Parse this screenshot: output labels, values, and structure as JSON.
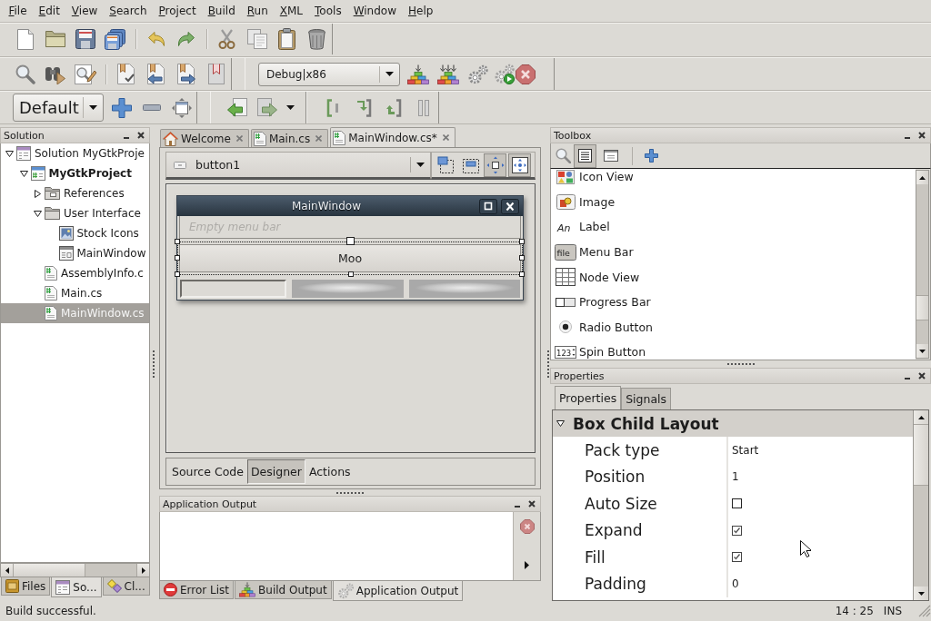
{
  "menu_bar": [
    "File",
    "Edit",
    "View",
    "Search",
    "Project",
    "Build",
    "Run",
    "XML",
    "Tools",
    "Window",
    "Help"
  ],
  "toolbars": {
    "configuration": "Debug|x86",
    "layout": "Default"
  },
  "solution_pad": {
    "title": "Solution",
    "tree": [
      {
        "label": "Solution MyGtkProje",
        "kind": "solution",
        "expanded": true,
        "selected": false,
        "children": [
          {
            "label": "MyGtkProject",
            "kind": "project",
            "expanded": true,
            "selected": false,
            "children": [
              {
                "label": "References",
                "kind": "references",
                "expanded": false,
                "selected": false
              },
              {
                "label": "User Interface",
                "kind": "folder",
                "expanded": true,
                "selected": false,
                "children": [
                  {
                    "label": "Stock Icons",
                    "kind": "stockicons",
                    "selected": false
                  },
                  {
                    "label": "MainWindow",
                    "kind": "window",
                    "selected": false
                  }
                ]
              },
              {
                "label": "AssemblyInfo.c",
                "kind": "source",
                "selected": false
              },
              {
                "label": "Main.cs",
                "kind": "source",
                "selected": false
              },
              {
                "label": "MainWindow.cs",
                "kind": "source",
                "selected": true
              }
            ]
          }
        ]
      }
    ],
    "tabs": [
      {
        "label": "Files",
        "kind": "files",
        "selected": false
      },
      {
        "label": "So...",
        "kind": "solution",
        "selected": true
      },
      {
        "label": "Cl...",
        "kind": "classes",
        "selected": false
      }
    ]
  },
  "document_tabs": [
    {
      "label": "Welcome",
      "kind": "welcome",
      "selected": false
    },
    {
      "label": "Main.cs",
      "kind": "source",
      "selected": false
    },
    {
      "label": "MainWindow.cs*",
      "kind": "source",
      "selected": true
    }
  ],
  "designer": {
    "widget_combo": "button1",
    "tool_buttons": [
      {
        "pressed": false
      },
      {
        "pressed": false
      },
      {
        "pressed": true
      },
      {
        "pressed": true
      }
    ],
    "preview_window": {
      "title": "MainWindow",
      "menu_bar": {
        "placeholder": "Empty menu bar"
      },
      "button_label": "Moo"
    },
    "view_tabs": [
      {
        "label": "Source Code",
        "selected": false
      },
      {
        "label": "Designer",
        "selected": true
      },
      {
        "label": "Actions",
        "selected": false
      }
    ]
  },
  "output_pad": {
    "title": "Application Output",
    "tabs": [
      {
        "label": "Error List",
        "kind": "errors",
        "selected": false
      },
      {
        "label": "Build Output",
        "kind": "build",
        "selected": false
      },
      {
        "label": "Application Output",
        "kind": "output",
        "selected": true
      }
    ]
  },
  "toolbox": {
    "title": "Toolbox",
    "view_toggles": [
      {
        "pressed": true
      },
      {
        "pressed": false
      }
    ],
    "items": [
      {
        "label": "Icon View",
        "kind": "iconview"
      },
      {
        "label": "Image",
        "kind": "image"
      },
      {
        "label": "Label",
        "kind": "label",
        "icon_text": "An"
      },
      {
        "label": "Menu Bar",
        "kind": "menubar",
        "icon_text": "file"
      },
      {
        "label": "Node View",
        "kind": "nodeview"
      },
      {
        "label": "Progress Bar",
        "kind": "progressbar"
      },
      {
        "label": "Radio Button",
        "kind": "radiobutton"
      },
      {
        "label": "Spin Button",
        "kind": "spinbutton",
        "icon_text": "123"
      }
    ]
  },
  "properties": {
    "title": "Properties",
    "tabs": [
      {
        "label": "Properties",
        "selected": true
      },
      {
        "label": "Signals",
        "selected": false
      }
    ],
    "category": {
      "label": "Box Child Layout",
      "expanded": true
    },
    "rows": [
      {
        "name": "Pack type",
        "kind": "text",
        "value": "Start"
      },
      {
        "name": "Position",
        "kind": "text",
        "value": "1"
      },
      {
        "name": "Auto Size",
        "kind": "checkbox",
        "checked": false
      },
      {
        "name": "Expand",
        "kind": "checkbox",
        "checked": true
      },
      {
        "name": "Fill",
        "kind": "checkbox",
        "checked": true
      },
      {
        "name": "Padding",
        "kind": "text",
        "value": "0"
      }
    ]
  },
  "status_bar": {
    "message": "Build successful.",
    "position": "14 : 25",
    "mode": "INS"
  }
}
